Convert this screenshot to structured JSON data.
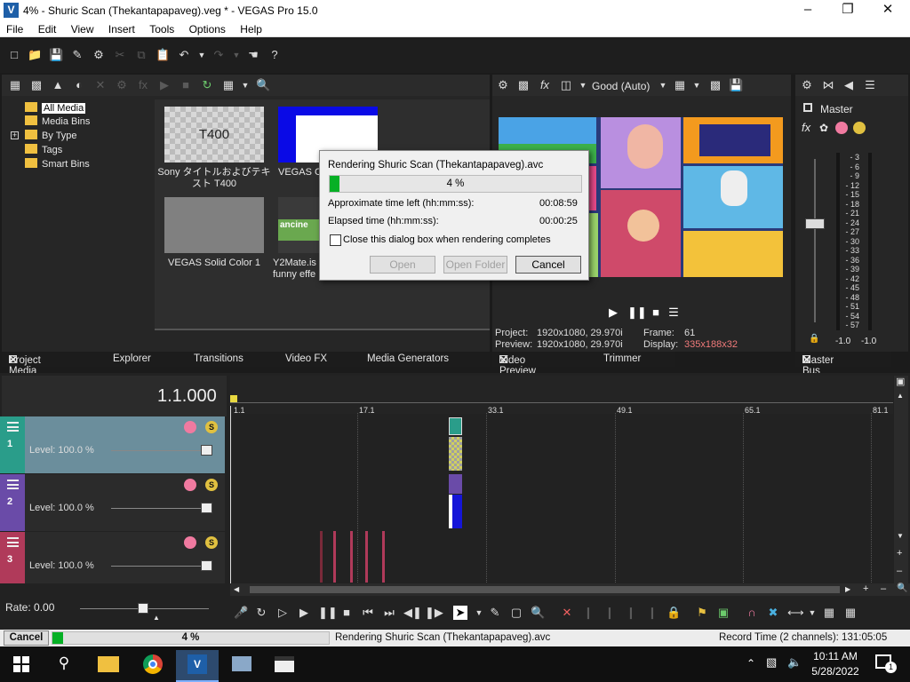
{
  "window": {
    "title": "4% - Shuric Scan (Thekantapapaveg).veg * - VEGAS Pro 15.0",
    "app_icon_letter": "V"
  },
  "menu": [
    "File",
    "Edit",
    "View",
    "Insert",
    "Tools",
    "Options",
    "Help"
  ],
  "project_media": {
    "tree": [
      "All Media",
      "Media Bins",
      "By Type",
      "Tags",
      "Smart Bins"
    ],
    "items": [
      {
        "label": "Sony タイトルおよびテキスト T400",
        "thumb_text": "T400"
      },
      {
        "label": "VEGAS Ch"
      },
      {
        "label": "VEGAS Solid Color 1"
      },
      {
        "label": "Y2Mate.is funny effe"
      }
    ]
  },
  "left_tabs": [
    "Project Media",
    "Explorer",
    "Transitions",
    "Video FX",
    "Media Generators"
  ],
  "preview": {
    "quality": "Good (Auto)",
    "project_label": "Project:",
    "project_value": "1920x1080, 29.970i",
    "preview_label": "Preview:",
    "preview_value": "1920x1080, 29.970i",
    "frame_label": "Frame:",
    "frame_value": "61",
    "display_label": "Display:",
    "display_value": "335x188x32"
  },
  "preview_tabs": [
    "Video Preview",
    "Trimmer"
  ],
  "master": {
    "title": "Master",
    "tab": "Master Bus",
    "scale": [
      "3",
      "6",
      "9",
      "12",
      "15",
      "18",
      "21",
      "24",
      "27",
      "30",
      "33",
      "36",
      "39",
      "42",
      "45",
      "48",
      "51",
      "54",
      "57"
    ],
    "left_value": "-1.0",
    "right_value": "-1.0"
  },
  "timeline": {
    "time": "1.1.000",
    "ruler": [
      "1.1",
      "17.1",
      "33.1",
      "49.1",
      "65.1",
      "81.1"
    ],
    "tracks": [
      {
        "num": "1",
        "level": "Level: 100.0 %",
        "color": "#2a9d8a"
      },
      {
        "num": "2",
        "level": "Level: 100.0 %",
        "color": "#6a4ba8"
      },
      {
        "num": "3",
        "level": "Level: 100.0 %",
        "color": "#b03a5a"
      }
    ],
    "rate": "Rate: 0.00"
  },
  "dialog": {
    "title": "Rendering Shuric Scan (Thekantapapaveg).avc",
    "progress_text": "4 %",
    "progress": 0.04,
    "time_left_label": "Approximate time left (hh:mm:ss):",
    "time_left": "00:08:59",
    "elapsed_label": "Elapsed time (hh:mm:ss):",
    "elapsed": "00:00:25",
    "checkbox_label": "Close this dialog box when rendering completes",
    "open": "Open",
    "open_folder": "Open Folder",
    "cancel": "Cancel"
  },
  "statusbar": {
    "cancel": "Cancel",
    "progress_text": "4 %",
    "message": "Rendering Shuric Scan (Thekantapapaveg).avc",
    "record_time": "Record Time (2 channels): 131:05:05"
  },
  "taskbar": {
    "time": "10:11 AM",
    "date": "5/28/2022",
    "notifications": "1"
  }
}
